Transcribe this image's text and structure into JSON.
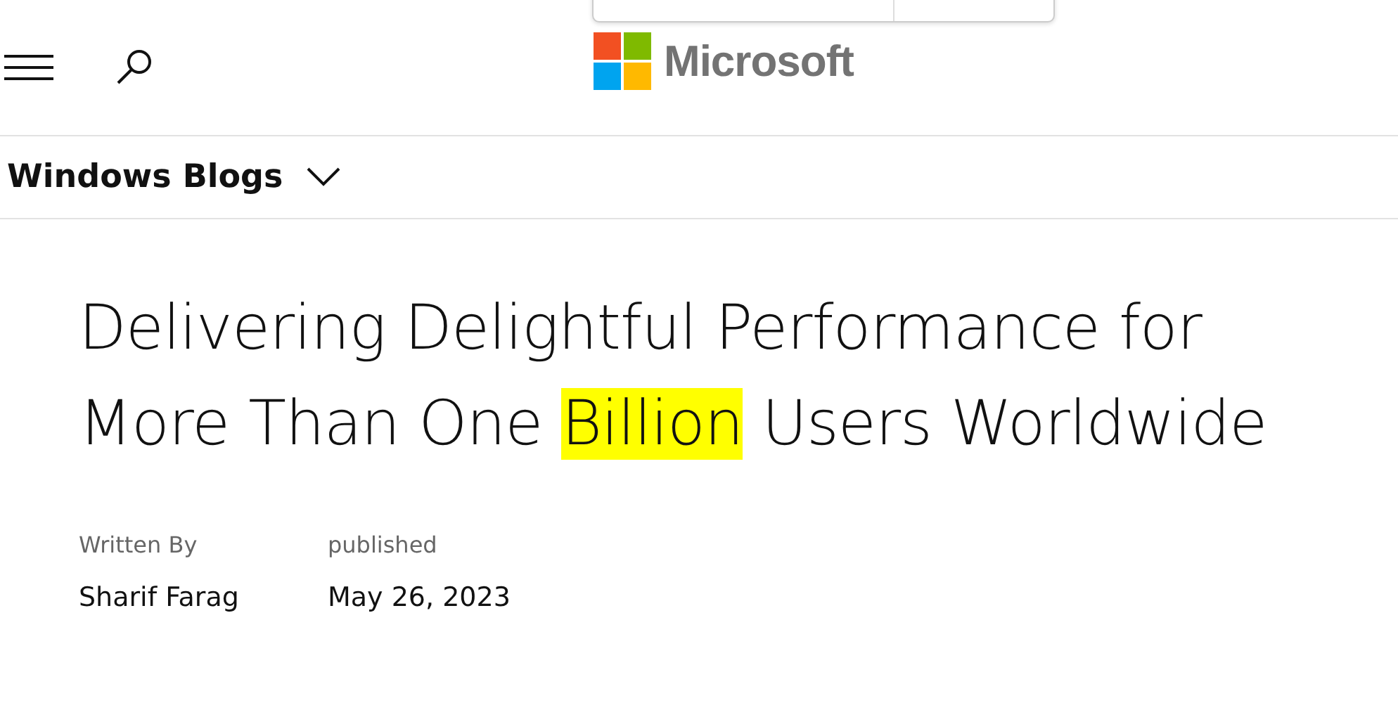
{
  "header": {
    "logo": "Microsoft"
  },
  "nav": {
    "label": "Windows Blogs",
    "expanded": false
  },
  "article": {
    "title": [
      {
        "text": "Delivering Delightful Performance for More Than One ",
        "highlighted": false
      },
      {
        "text": "Billion",
        "highlighted": true
      },
      {
        "text": " Users Worldwide",
        "highlighted": false
      }
    ],
    "meta": [
      {
        "label": "Written By",
        "value": "Sharif Farag"
      },
      {
        "label": "published",
        "value": "May 26, 2023"
      }
    ]
  }
}
